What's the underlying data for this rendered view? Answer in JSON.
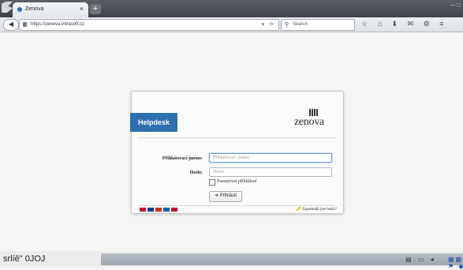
{
  "browser": {
    "tab_title": "Zenova",
    "url": "https://zenova.intrasoft.cz",
    "search_placeholder": "Search"
  },
  "login": {
    "helpdesk_label": "Helpdesk",
    "logo_text": "zenova",
    "username_label": "Přihlašovací jméno:",
    "username_placeholder": "Přihlašovací jméno",
    "password_label": "Heslo:",
    "password_placeholder": "Heslo",
    "remember_label": "Pamatovat přihlášení",
    "login_button": "Přihlásit",
    "forgot_link": "Zapomněli jste heslo?"
  },
  "language_flags": [
    "#c8102e",
    "#1a3d8f",
    "#d52b1e",
    "#005bbb",
    "#c60c30"
  ],
  "taskbar": {
    "left_text": "srlíě\"   0JOJ",
    "clock_time": "",
    "clock_date": ""
  },
  "colors": {
    "accent": "#2f6eb0"
  }
}
